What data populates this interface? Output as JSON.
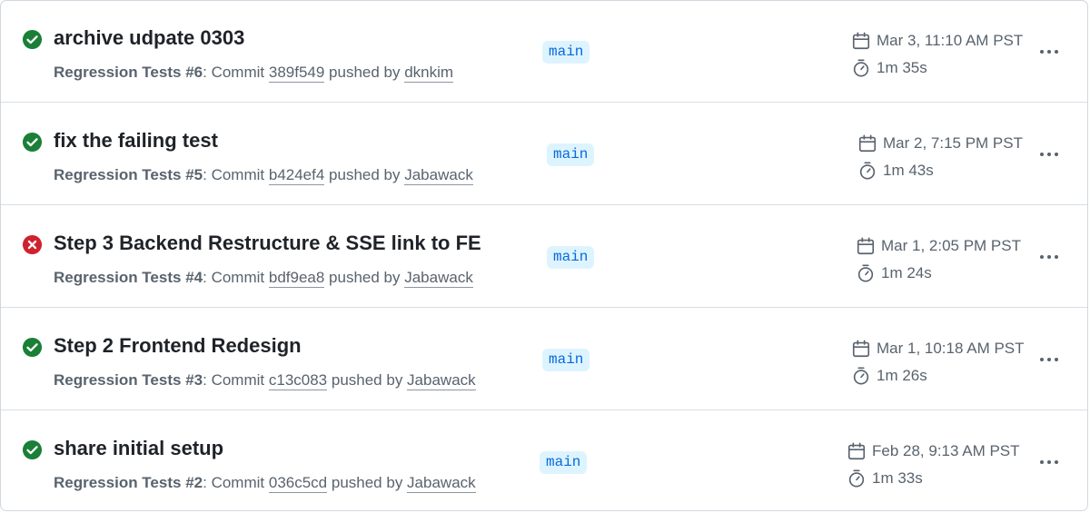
{
  "runs": [
    {
      "status": "success",
      "status_icon": "check-circle-icon",
      "title": "archive udpate 0303",
      "workflow": "Regression Tests",
      "run_number": "#6",
      "commit_prefix": ": Commit ",
      "commit": "389f549",
      "pushed_by_text": " pushed by ",
      "author": "dknkim",
      "branch": "main",
      "date": "Mar 3, 11:10 AM PST",
      "duration": "1m 35s"
    },
    {
      "status": "success",
      "status_icon": "check-circle-icon",
      "title": "fix the failing test",
      "workflow": "Regression Tests",
      "run_number": "#5",
      "commit_prefix": ": Commit ",
      "commit": "b424ef4",
      "pushed_by_text": " pushed by ",
      "author": "Jabawack",
      "branch": "main",
      "date": "Mar 2, 7:15 PM PST",
      "duration": "1m 43s"
    },
    {
      "status": "failure",
      "status_icon": "x-circle-icon",
      "title": "Step 3 Backend Restructure & SSE link to FE",
      "workflow": "Regression Tests",
      "run_number": "#4",
      "commit_prefix": ": Commit ",
      "commit": "bdf9ea8",
      "pushed_by_text": " pushed by ",
      "author": "Jabawack",
      "branch": "main",
      "date": "Mar 1, 2:05 PM PST",
      "duration": "1m 24s"
    },
    {
      "status": "success",
      "status_icon": "check-circle-icon",
      "title": "Step 2 Frontend Redesign",
      "workflow": "Regression Tests",
      "run_number": "#3",
      "commit_prefix": ": Commit ",
      "commit": "c13c083",
      "pushed_by_text": " pushed by ",
      "author": "Jabawack",
      "branch": "main",
      "date": "Mar 1, 10:18 AM PST",
      "duration": "1m 26s"
    },
    {
      "status": "success",
      "status_icon": "check-circle-icon",
      "title": "share initial setup",
      "workflow": "Regression Tests",
      "run_number": "#2",
      "commit_prefix": ": Commit ",
      "commit": "036c5cd",
      "pushed_by_text": " pushed by ",
      "author": "Jabawack",
      "branch": "main",
      "date": "Feb 28, 9:13 AM PST",
      "duration": "1m 33s"
    }
  ],
  "icons": {
    "date": "calendar-icon",
    "duration": "stopwatch-icon",
    "menu": "kebab-horizontal-icon"
  },
  "colors": {
    "success": "#1a7f37",
    "failure": "#cf222e",
    "branch_bg": "#ddf4ff",
    "branch_fg": "#0969da",
    "muted_text": "#59636e"
  }
}
